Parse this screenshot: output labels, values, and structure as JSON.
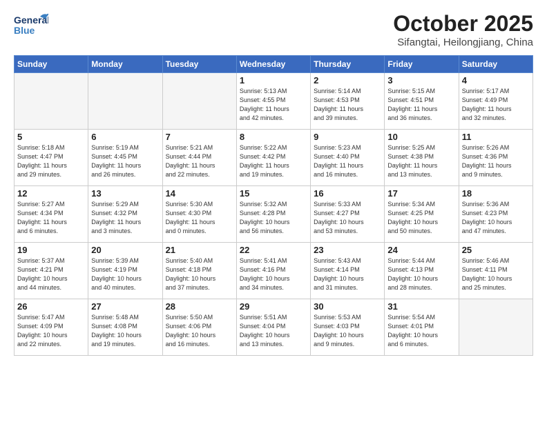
{
  "header": {
    "logo_general": "General",
    "logo_blue": "Blue",
    "month": "October 2025",
    "location": "Sifangtai, Heilongjiang, China"
  },
  "weekdays": [
    "Sunday",
    "Monday",
    "Tuesday",
    "Wednesday",
    "Thursday",
    "Friday",
    "Saturday"
  ],
  "weeks": [
    [
      {
        "day": "",
        "info": ""
      },
      {
        "day": "",
        "info": ""
      },
      {
        "day": "",
        "info": ""
      },
      {
        "day": "1",
        "info": "Sunrise: 5:13 AM\nSunset: 4:55 PM\nDaylight: 11 hours\nand 42 minutes."
      },
      {
        "day": "2",
        "info": "Sunrise: 5:14 AM\nSunset: 4:53 PM\nDaylight: 11 hours\nand 39 minutes."
      },
      {
        "day": "3",
        "info": "Sunrise: 5:15 AM\nSunset: 4:51 PM\nDaylight: 11 hours\nand 36 minutes."
      },
      {
        "day": "4",
        "info": "Sunrise: 5:17 AM\nSunset: 4:49 PM\nDaylight: 11 hours\nand 32 minutes."
      }
    ],
    [
      {
        "day": "5",
        "info": "Sunrise: 5:18 AM\nSunset: 4:47 PM\nDaylight: 11 hours\nand 29 minutes."
      },
      {
        "day": "6",
        "info": "Sunrise: 5:19 AM\nSunset: 4:45 PM\nDaylight: 11 hours\nand 26 minutes."
      },
      {
        "day": "7",
        "info": "Sunrise: 5:21 AM\nSunset: 4:44 PM\nDaylight: 11 hours\nand 22 minutes."
      },
      {
        "day": "8",
        "info": "Sunrise: 5:22 AM\nSunset: 4:42 PM\nDaylight: 11 hours\nand 19 minutes."
      },
      {
        "day": "9",
        "info": "Sunrise: 5:23 AM\nSunset: 4:40 PM\nDaylight: 11 hours\nand 16 minutes."
      },
      {
        "day": "10",
        "info": "Sunrise: 5:25 AM\nSunset: 4:38 PM\nDaylight: 11 hours\nand 13 minutes."
      },
      {
        "day": "11",
        "info": "Sunrise: 5:26 AM\nSunset: 4:36 PM\nDaylight: 11 hours\nand 9 minutes."
      }
    ],
    [
      {
        "day": "12",
        "info": "Sunrise: 5:27 AM\nSunset: 4:34 PM\nDaylight: 11 hours\nand 6 minutes."
      },
      {
        "day": "13",
        "info": "Sunrise: 5:29 AM\nSunset: 4:32 PM\nDaylight: 11 hours\nand 3 minutes."
      },
      {
        "day": "14",
        "info": "Sunrise: 5:30 AM\nSunset: 4:30 PM\nDaylight: 11 hours\nand 0 minutes."
      },
      {
        "day": "15",
        "info": "Sunrise: 5:32 AM\nSunset: 4:28 PM\nDaylight: 10 hours\nand 56 minutes."
      },
      {
        "day": "16",
        "info": "Sunrise: 5:33 AM\nSunset: 4:27 PM\nDaylight: 10 hours\nand 53 minutes."
      },
      {
        "day": "17",
        "info": "Sunrise: 5:34 AM\nSunset: 4:25 PM\nDaylight: 10 hours\nand 50 minutes."
      },
      {
        "day": "18",
        "info": "Sunrise: 5:36 AM\nSunset: 4:23 PM\nDaylight: 10 hours\nand 47 minutes."
      }
    ],
    [
      {
        "day": "19",
        "info": "Sunrise: 5:37 AM\nSunset: 4:21 PM\nDaylight: 10 hours\nand 44 minutes."
      },
      {
        "day": "20",
        "info": "Sunrise: 5:39 AM\nSunset: 4:19 PM\nDaylight: 10 hours\nand 40 minutes."
      },
      {
        "day": "21",
        "info": "Sunrise: 5:40 AM\nSunset: 4:18 PM\nDaylight: 10 hours\nand 37 minutes."
      },
      {
        "day": "22",
        "info": "Sunrise: 5:41 AM\nSunset: 4:16 PM\nDaylight: 10 hours\nand 34 minutes."
      },
      {
        "day": "23",
        "info": "Sunrise: 5:43 AM\nSunset: 4:14 PM\nDaylight: 10 hours\nand 31 minutes."
      },
      {
        "day": "24",
        "info": "Sunrise: 5:44 AM\nSunset: 4:13 PM\nDaylight: 10 hours\nand 28 minutes."
      },
      {
        "day": "25",
        "info": "Sunrise: 5:46 AM\nSunset: 4:11 PM\nDaylight: 10 hours\nand 25 minutes."
      }
    ],
    [
      {
        "day": "26",
        "info": "Sunrise: 5:47 AM\nSunset: 4:09 PM\nDaylight: 10 hours\nand 22 minutes."
      },
      {
        "day": "27",
        "info": "Sunrise: 5:48 AM\nSunset: 4:08 PM\nDaylight: 10 hours\nand 19 minutes."
      },
      {
        "day": "28",
        "info": "Sunrise: 5:50 AM\nSunset: 4:06 PM\nDaylight: 10 hours\nand 16 minutes."
      },
      {
        "day": "29",
        "info": "Sunrise: 5:51 AM\nSunset: 4:04 PM\nDaylight: 10 hours\nand 13 minutes."
      },
      {
        "day": "30",
        "info": "Sunrise: 5:53 AM\nSunset: 4:03 PM\nDaylight: 10 hours\nand 9 minutes."
      },
      {
        "day": "31",
        "info": "Sunrise: 5:54 AM\nSunset: 4:01 PM\nDaylight: 10 hours\nand 6 minutes."
      },
      {
        "day": "",
        "info": ""
      }
    ]
  ]
}
